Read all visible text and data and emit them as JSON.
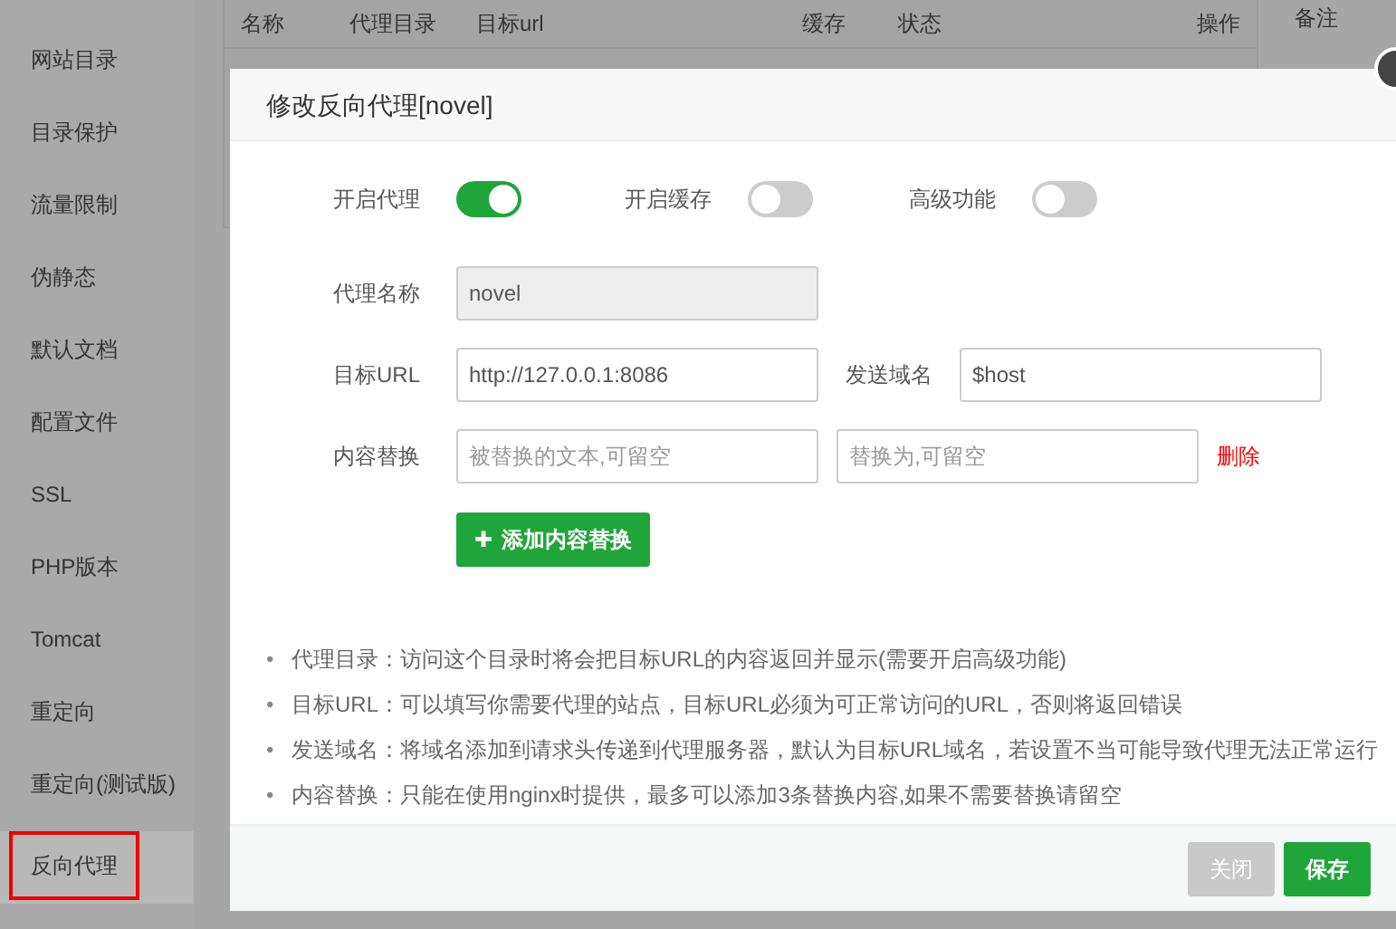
{
  "sidebar": {
    "items": [
      {
        "label": "网站目录",
        "selected": false
      },
      {
        "label": "目录保护",
        "selected": false
      },
      {
        "label": "流量限制",
        "selected": false
      },
      {
        "label": "伪静态",
        "selected": false
      },
      {
        "label": "默认文档",
        "selected": false
      },
      {
        "label": "配置文件",
        "selected": false
      },
      {
        "label": "SSL",
        "selected": false
      },
      {
        "label": "PHP版本",
        "selected": false
      },
      {
        "label": "Tomcat",
        "selected": false
      },
      {
        "label": "重定向",
        "selected": false
      },
      {
        "label": "重定向(测试版)",
        "selected": false
      },
      {
        "label": "反向代理",
        "selected": true
      }
    ]
  },
  "table": {
    "columns": [
      "名称",
      "代理目录",
      "目标url",
      "缓存",
      "状态",
      "操作"
    ],
    "side_column": "备注"
  },
  "dialog": {
    "title": "修改反向代理[novel]",
    "toggles": [
      {
        "label": "开启代理",
        "on": true
      },
      {
        "label": "开启缓存",
        "on": false
      },
      {
        "label": "高级功能",
        "on": false
      }
    ],
    "name_field": {
      "label": "代理名称",
      "value": "novel",
      "disabled": true
    },
    "url_field": {
      "label": "目标URL",
      "value": "http://127.0.0.1:8086"
    },
    "host_field": {
      "label": "发送域名",
      "value": "$host"
    },
    "replace_row": {
      "label": "内容替换",
      "from_placeholder": "被替换的文本,可留空",
      "to_placeholder": "替换为,可留空",
      "delete": "删除"
    },
    "add_button": {
      "icon": "✚",
      "label": "添加内容替换"
    },
    "notes": [
      {
        "bullet": "•",
        "text": "代理目录：访问这个目录时将会把目标URL的内容返回并显示(需要开启高级功能)"
      },
      {
        "bullet": "•",
        "text": "目标URL：可以填写你需要代理的站点，目标URL必须为可正常访问的URL，否则将返回错误"
      },
      {
        "bullet": "•",
        "text": "发送域名：将域名添加到请求头传递到代理服务器，默认为目标URL域名，若设置不当可能导致代理无法正常运行"
      },
      {
        "bullet": "•",
        "text": "内容替换：只能在使用nginx时提供，最多可以添加3条替换内容,如果不需要替换请留空"
      }
    ],
    "buttons": [
      {
        "label": "关闭",
        "kind": "secondary"
      },
      {
        "label": "保存",
        "kind": "primary"
      }
    ]
  }
}
